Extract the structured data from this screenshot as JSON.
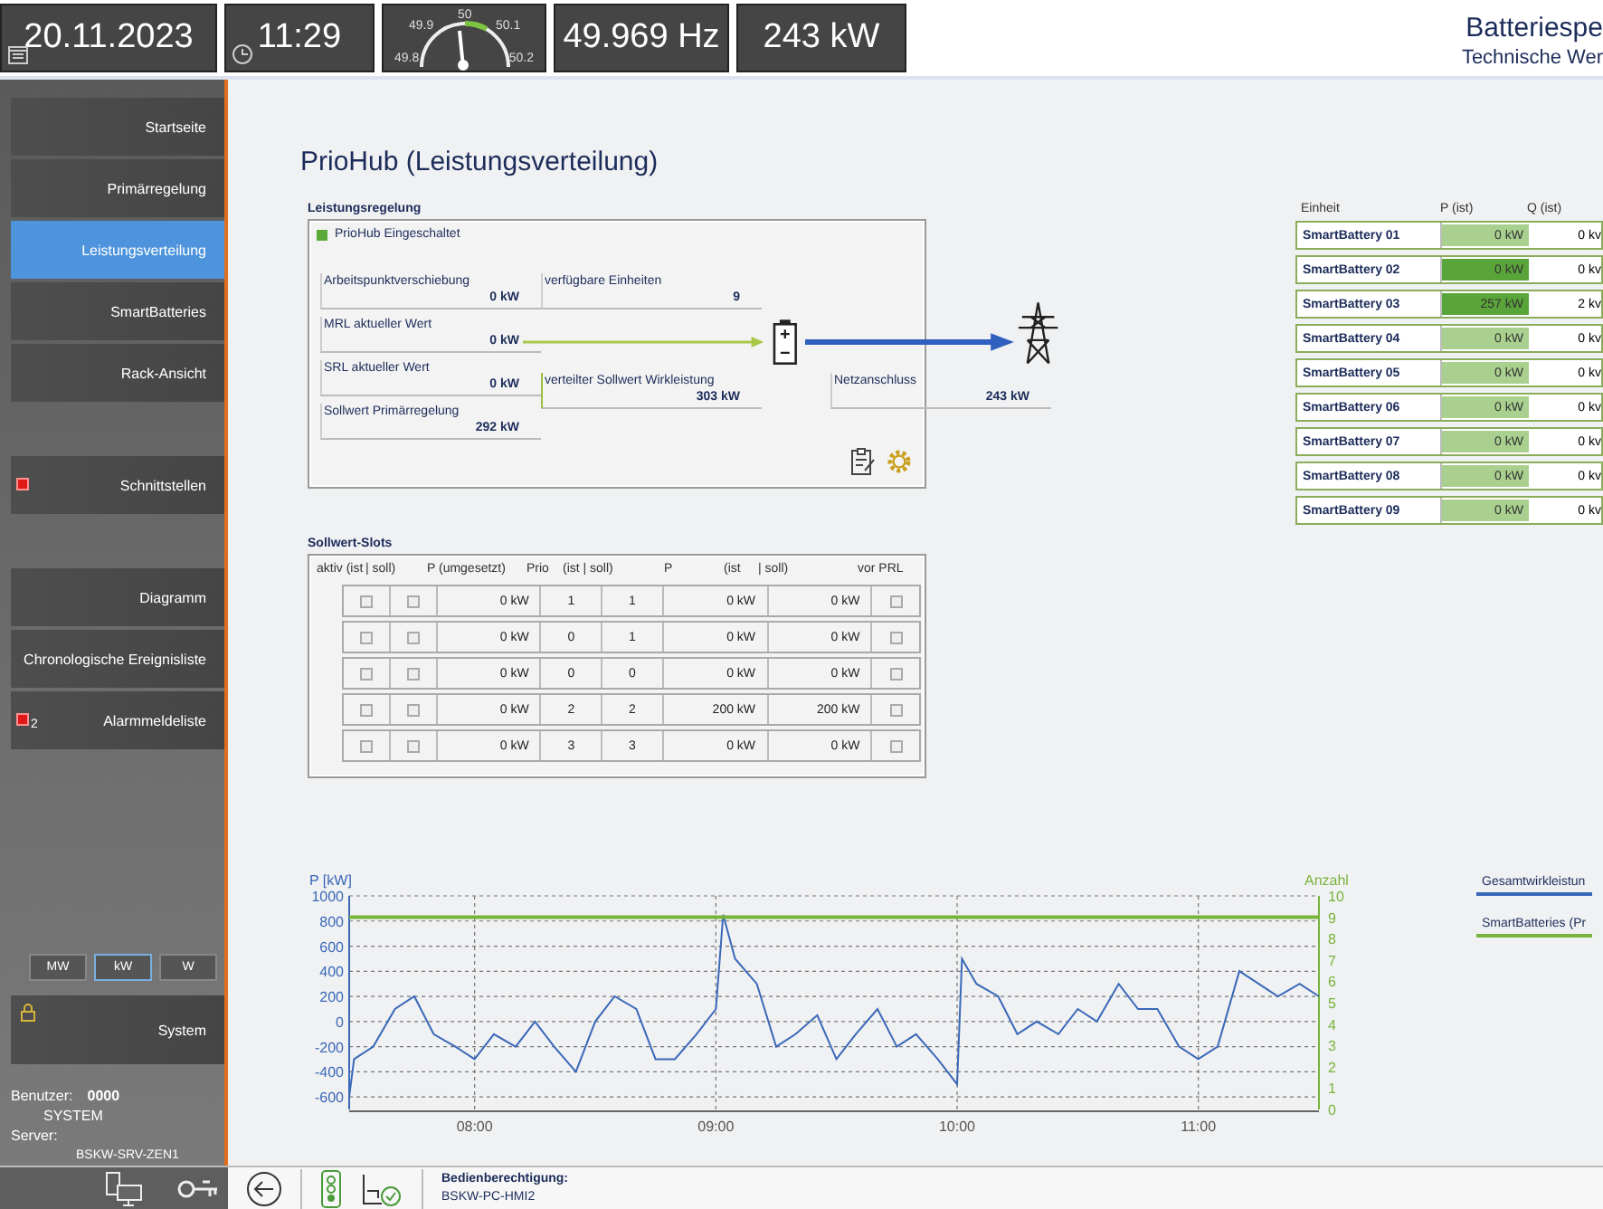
{
  "header": {
    "date": "20.11.2023",
    "time": "11:29",
    "gauge_labels": [
      "49.9",
      "50",
      "50.1",
      "49.8",
      "50.2"
    ],
    "frequency": "49.969 Hz",
    "power": "243 kW",
    "title": "Batteriespe",
    "subtitle": "Technische Wer"
  },
  "sidebar": {
    "groups": [
      [
        {
          "label": "Startseite",
          "selected": false,
          "alarm": false
        },
        {
          "label": "Primärregelung",
          "selected": false,
          "alarm": false
        },
        {
          "label": "Leistungsverteilung",
          "selected": true,
          "alarm": false
        },
        {
          "label": "SmartBatteries",
          "selected": false,
          "alarm": false
        },
        {
          "label": "Rack-Ansicht",
          "selected": false,
          "alarm": false
        }
      ],
      [
        {
          "label": "Schnittstellen",
          "selected": false,
          "alarm": true
        }
      ],
      [
        {
          "label": "Diagramm",
          "selected": false,
          "alarm": false
        },
        {
          "label": "Chronologische Ereignisliste",
          "selected": false,
          "alarm": false
        },
        {
          "label": "Alarmmeldeliste",
          "selected": false,
          "alarm": true,
          "badge": "2"
        }
      ]
    ],
    "units": [
      {
        "label": "MW",
        "selected": false
      },
      {
        "label": "kW",
        "selected": true
      },
      {
        "label": "W",
        "selected": false
      }
    ],
    "system": {
      "label": "System",
      "locked": true
    },
    "user_label": "Benutzer:",
    "user_id": "0000",
    "user_name": "SYSTEM",
    "server_label": "Server:",
    "server": "BSKW-SRV-ZEN1"
  },
  "page_title": "PrioHub (Leistungsverteilung)",
  "control": {
    "title": "Leistungsregelung",
    "status": {
      "label": "PrioHub Eingeschaltet",
      "on": true
    },
    "inputs": [
      {
        "label": "Arbeitspunktverschiebung",
        "value": "0 kW"
      },
      {
        "label": "MRL aktueller Wert",
        "value": "0 kW"
      },
      {
        "label": "SRL aktueller Wert",
        "value": "0 kW"
      },
      {
        "label": "Sollwert Primärregelung",
        "value": "292 kW"
      }
    ],
    "units_available": {
      "label": "verfügbare Einheiten",
      "value": "9"
    },
    "distributed": {
      "label": "verteilter Sollwert Wirkleistung",
      "value": "303 kW"
    },
    "grid": {
      "label": "Netzanschluss",
      "value": "243 kW"
    }
  },
  "units_table": {
    "columns": [
      "Einheit",
      "P (ist)",
      "Q (ist)"
    ],
    "rows": [
      {
        "name": "SmartBattery 01",
        "p": "0 kW",
        "q": "0 kv",
        "active": false
      },
      {
        "name": "SmartBattery 02",
        "p": "0 kW",
        "q": "0 kv",
        "active": true
      },
      {
        "name": "SmartBattery 03",
        "p": "257 kW",
        "q": "2 kv",
        "active": true
      },
      {
        "name": "SmartBattery 04",
        "p": "0 kW",
        "q": "0 kv",
        "active": false
      },
      {
        "name": "SmartBattery 05",
        "p": "0 kW",
        "q": "0 kv",
        "active": false
      },
      {
        "name": "SmartBattery 06",
        "p": "0 kW",
        "q": "0 kv",
        "active": false
      },
      {
        "name": "SmartBattery 07",
        "p": "0 kW",
        "q": "0 kv",
        "active": false
      },
      {
        "name": "SmartBattery 08",
        "p": "0 kW",
        "q": "0 kv",
        "active": false
      },
      {
        "name": "SmartBattery 09",
        "p": "0 kW",
        "q": "0 kv",
        "active": false
      }
    ]
  },
  "slots": {
    "title": "Sollwert-Slots",
    "columns": [
      "aktiv (ist",
      "| soll)",
      "P (umgesetzt)",
      "Prio",
      "(ist | soll)",
      "P",
      "(ist",
      "| soll)",
      "vor PRL"
    ],
    "rows": [
      {
        "active_ist": false,
        "active_soll": false,
        "p_applied": "0 kW",
        "prio_ist": "1",
        "prio_soll": "1",
        "p_ist": "0 kW",
        "p_soll": "0 kW",
        "before_prl": false
      },
      {
        "active_ist": false,
        "active_soll": false,
        "p_applied": "0 kW",
        "prio_ist": "0",
        "prio_soll": "1",
        "p_ist": "0 kW",
        "p_soll": "0 kW",
        "before_prl": false
      },
      {
        "active_ist": false,
        "active_soll": false,
        "p_applied": "0 kW",
        "prio_ist": "0",
        "prio_soll": "0",
        "p_ist": "0 kW",
        "p_soll": "0 kW",
        "before_prl": false
      },
      {
        "active_ist": false,
        "active_soll": false,
        "p_applied": "0 kW",
        "prio_ist": "2",
        "prio_soll": "2",
        "p_ist": "200 kW",
        "p_soll": "200 kW",
        "before_prl": false
      },
      {
        "active_ist": false,
        "active_soll": false,
        "p_applied": "0 kW",
        "prio_ist": "3",
        "prio_soll": "3",
        "p_ist": "0 kW",
        "p_soll": "0 kW",
        "before_prl": false
      }
    ]
  },
  "chart": {
    "chart_data": {
      "type": "line",
      "grid": true,
      "ylabel": "P [kW]",
      "y2label": "Anzahl",
      "xlim": [
        7.48,
        11.5
      ],
      "ylim": [
        -700,
        1000
      ],
      "y2lim": [
        0,
        10
      ],
      "xticks": [
        {
          "value": 8,
          "label": "08:00"
        },
        {
          "value": 9,
          "label": "09:00"
        },
        {
          "value": 10,
          "label": "10:00"
        },
        {
          "value": 11,
          "label": "11:00"
        }
      ],
      "yticks": [
        -600,
        -400,
        -200,
        0,
        200,
        400,
        600,
        800,
        1000
      ],
      "y2ticks": [
        0,
        1,
        2,
        3,
        4,
        5,
        6,
        7,
        8,
        9,
        10
      ],
      "x": [
        7.48,
        7.5,
        7.58,
        7.67,
        7.75,
        7.83,
        7.92,
        8,
        8.08,
        8.17,
        8.25,
        8.33,
        8.42,
        8.5,
        8.58,
        8.67,
        8.75,
        8.83,
        8.92,
        9,
        9.03,
        9.08,
        9.17,
        9.25,
        9.33,
        9.42,
        9.5,
        9.58,
        9.67,
        9.75,
        9.83,
        9.92,
        10,
        10.02,
        10.08,
        10.17,
        10.25,
        10.33,
        10.42,
        10.5,
        10.58,
        10.67,
        10.75,
        10.83,
        10.92,
        11,
        11.08,
        11.17,
        11.25,
        11.33,
        11.42,
        11.5
      ],
      "series": [
        {
          "name": "Gesamtwirkleistun",
          "color": "#3a68b8",
          "values": [
            -600,
            -300,
            -200,
            100,
            200,
            -100,
            -200,
            -300,
            -100,
            -200,
            0,
            -200,
            -400,
            0,
            200,
            100,
            -300,
            -300,
            -100,
            100,
            850,
            500,
            300,
            -200,
            -100,
            50,
            -300,
            -100,
            100,
            -200,
            -100,
            -300,
            -500,
            500,
            300,
            200,
            -100,
            0,
            -100,
            100,
            0,
            300,
            100,
            100,
            -200,
            -300,
            -200,
            400,
            300,
            200,
            300,
            200
          ]
        },
        {
          "name": "SmartBatteries (Pr",
          "color": "#78b43c",
          "axis": "y2",
          "values": [
            9,
            9,
            9,
            9,
            9,
            9,
            9,
            9,
            9,
            9,
            9,
            9,
            9,
            9,
            9,
            9,
            9,
            9,
            9,
            9,
            9,
            9,
            9,
            9,
            9,
            9,
            9,
            9,
            9,
            9,
            9,
            9,
            9,
            9,
            9,
            9,
            9,
            9,
            9,
            9,
            9,
            9,
            9,
            9,
            9,
            9,
            9,
            9,
            9,
            9,
            9,
            9
          ]
        }
      ]
    }
  },
  "footer": {
    "permission_label": "Bedienberechtigung:",
    "permission_value": "BSKW-PC-HMI2"
  }
}
